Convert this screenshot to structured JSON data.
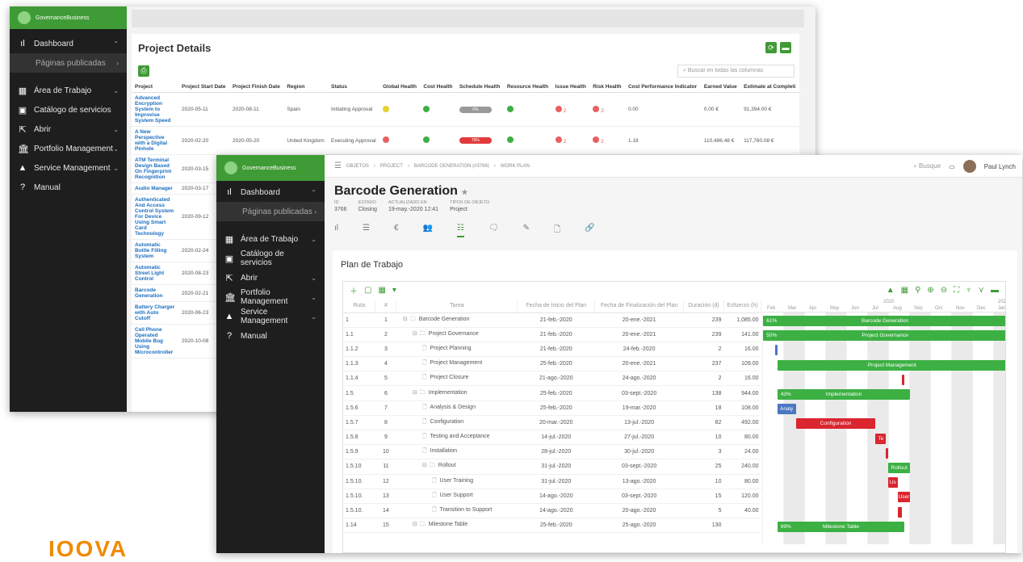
{
  "brand": "IOOVA",
  "colors": {
    "accent": "#3f9b35",
    "red": "#d9262f",
    "link": "#1a6fc0"
  },
  "back": {
    "logo": "GovernanceBusiness",
    "nav": [
      {
        "label": "Dashboard",
        "icon": "bar-chart-icon"
      },
      {
        "label": "Páginas publicadas",
        "sub": true
      },
      {
        "label": "Área de Trabajo",
        "icon": "grid-icon"
      },
      {
        "label": "Catálogo de servicios",
        "icon": "book-icon"
      },
      {
        "label": "Abrir",
        "icon": "open-icon"
      },
      {
        "label": "Portfolio Management",
        "icon": "bank-icon"
      },
      {
        "label": "Service Management",
        "icon": "mountain-icon"
      },
      {
        "label": "Manual",
        "icon": "question-icon"
      }
    ],
    "title": "Project Details",
    "search_placeholder": "Buscar en todas las columnas",
    "columns": [
      "Project",
      "Project Start Date",
      "Project Finish Date",
      "Region",
      "Status",
      "Global Health",
      "Cost Health",
      "Schedule Health",
      "Resource Health",
      "Issue Health",
      "Risk Health",
      "Cost Performance Indicator",
      "Earned Value",
      "Estimate at Completi"
    ],
    "rows": [
      {
        "project": "Advanced Encryption System to Improvise System Speed",
        "start": "2020-05-11",
        "finish": "2020-08-11",
        "region": "Spain",
        "status": "Initiating Approval",
        "global": "#e2d130",
        "cost": "#3cb043",
        "schedule": "0%",
        "schedule_color": "#999999",
        "resource": "#3cb043",
        "issue": "2",
        "risk": "2",
        "cpi": "0.00",
        "ev": "0.00 €",
        "eac": "91,394.00 €"
      },
      {
        "project": "A New Perspective with a Digital Pinhole",
        "start": "2020-02-20",
        "finish": "2020-05-20",
        "region": "United Kingdom",
        "status": "Executing Approval",
        "global": "#e86060",
        "cost": "#3cb043",
        "schedule": "79%",
        "schedule_color": "#e23b3b",
        "resource": "#3cb043",
        "issue": "2",
        "risk": "2",
        "cpi": "1.18",
        "ev": "110,486.48 €",
        "eac": "117,760.08 €"
      },
      {
        "project": "ATM Terminal Design Based On Fingerprint Recognition",
        "start": "2020-03-15"
      },
      {
        "project": "Audio Manager",
        "start": "2020-03-17"
      },
      {
        "project": "Authenticated And Access Control System For Device Using Smart Card Technology",
        "start": "2020-09-12"
      },
      {
        "project": "Automatic Bottle Filling System",
        "start": "2020-02-24"
      },
      {
        "project": "Automatic Street Light Control",
        "start": "2020-08-23"
      },
      {
        "project": "Barcode Generation",
        "start": "2020-02-21"
      },
      {
        "project": "Battery Charger with Auto Cutoff",
        "start": "2020-06-23"
      },
      {
        "project": "Cell Phone Operated Mobile Bug Using Microcontroller",
        "start": "2020-10-08"
      }
    ]
  },
  "front": {
    "breadcrumb": [
      "OBJETOS",
      "PROJECT",
      "BARCODE GENERATION (#3766)",
      "WORK PLAN"
    ],
    "search": "Busque",
    "user": "Paul Lynch",
    "title": "Barcode Generation",
    "meta": [
      {
        "k": "ID",
        "v": "3766"
      },
      {
        "k": "ESTADO",
        "v": "Closing"
      },
      {
        "k": "ACTUALIZADO EN",
        "v": "19-may.-2020 12:41"
      },
      {
        "k": "TIPOS DE OBJETO",
        "v": "Project"
      }
    ],
    "plan_title": "Plan de Trabajo",
    "columns": [
      "Ruta",
      "#",
      "Tarea",
      "Fecha de Inicio del Plan",
      "Fecha de Finalización del Plan",
      "Duración (d)",
      "Esfuerzo (h)"
    ],
    "year_labels": [
      "2020",
      "2021"
    ],
    "months": [
      "Feb",
      "Mar",
      "Apr",
      "May",
      "Jun",
      "Jul",
      "Aug",
      "Sep",
      "Oct",
      "Nov",
      "Dec",
      "Jan"
    ],
    "tasks": [
      {
        "ruta": "1",
        "n": "1",
        "name": "Barcode Generation",
        "level": 0,
        "type": "folder",
        "start": "21-feb.-2020",
        "end": "20-ene.-2021",
        "dur": "239",
        "eff": "1,085.00"
      },
      {
        "ruta": "1.1",
        "n": "2",
        "name": "Project Governance",
        "level": 1,
        "type": "folder",
        "start": "21-feb.-2020",
        "end": "20-ene.-2021",
        "dur": "239",
        "eff": "141.00"
      },
      {
        "ruta": "1.1.2",
        "n": "3",
        "name": "Project Planning",
        "level": 2,
        "type": "doc",
        "start": "21-feb.-2020",
        "end": "24-feb.-2020",
        "dur": "2",
        "eff": "16.00"
      },
      {
        "ruta": "1.1.3",
        "n": "4",
        "name": "Project Management",
        "level": 2,
        "type": "doc",
        "start": "25-feb.-2020",
        "end": "20-ene.-2021",
        "dur": "237",
        "eff": "109.00"
      },
      {
        "ruta": "1.1.4",
        "n": "5",
        "name": "Project Closure",
        "level": 2,
        "type": "doc",
        "start": "21-ago.-2020",
        "end": "24-ago.-2020",
        "dur": "2",
        "eff": "16.00"
      },
      {
        "ruta": "1.5",
        "n": "6",
        "name": "Implementation",
        "level": 1,
        "type": "folder",
        "start": "25-feb.-2020",
        "end": "03-sept.-2020",
        "dur": "138",
        "eff": "944.00"
      },
      {
        "ruta": "1.5.6",
        "n": "7",
        "name": "Analysis & Design",
        "level": 2,
        "type": "doc",
        "start": "25-feb.-2020",
        "end": "19-mar.-2020",
        "dur": "18",
        "eff": "108.00"
      },
      {
        "ruta": "1.5.7",
        "n": "8",
        "name": "Configuration",
        "level": 2,
        "type": "doc",
        "start": "20-mar.-2020",
        "end": "13-jul.-2020",
        "dur": "82",
        "eff": "492.00"
      },
      {
        "ruta": "1.5.8",
        "n": "9",
        "name": "Testing and Acceptance",
        "level": 2,
        "type": "doc",
        "start": "14-jul.-2020",
        "end": "27-jul.-2020",
        "dur": "10",
        "eff": "80.00"
      },
      {
        "ruta": "1.5.9",
        "n": "10",
        "name": "Installation",
        "level": 2,
        "type": "doc",
        "start": "28-jul.-2020",
        "end": "30-jul.-2020",
        "dur": "3",
        "eff": "24.00"
      },
      {
        "ruta": "1.5.10",
        "n": "11",
        "name": "Rollout",
        "level": 2,
        "type": "folder",
        "start": "31-jul.-2020",
        "end": "03-sept.-2020",
        "dur": "25",
        "eff": "240.00"
      },
      {
        "ruta": "1.5.10.",
        "n": "12",
        "name": "User Training",
        "level": 3,
        "type": "doc",
        "start": "31-jul.-2020",
        "end": "13-ago.-2020",
        "dur": "10",
        "eff": "80.00"
      },
      {
        "ruta": "1.5.10.",
        "n": "13",
        "name": "User Support",
        "level": 3,
        "type": "doc",
        "start": "14-ago.-2020",
        "end": "03-sept.-2020",
        "dur": "15",
        "eff": "120.00"
      },
      {
        "ruta": "1.5.10.",
        "n": "14",
        "name": "Transition to Support",
        "level": 3,
        "type": "doc",
        "start": "14-ago.-2020",
        "end": "20-ago.-2020",
        "dur": "5",
        "eff": "40.00"
      },
      {
        "ruta": "1.14",
        "n": "15",
        "name": "Milestone Table",
        "level": 1,
        "type": "folder",
        "start": "25-feb.-2020",
        "end": "25-ago.-2020",
        "dur": "130",
        "eff": ""
      }
    ],
    "bars": [
      {
        "row": 0,
        "s": 0.05,
        "e": 11.65,
        "c": "g",
        "label": "Barcode Generation",
        "pct": "61%"
      },
      {
        "row": 1,
        "s": 0.05,
        "e": 11.65,
        "c": "g",
        "label": "Project Governance",
        "pct": "50%"
      },
      {
        "row": 2,
        "s": 0.6,
        "e": 0.72,
        "c": "b",
        "label": "",
        "pct": ""
      },
      {
        "row": 3,
        "s": 0.72,
        "e": 11.65,
        "c": "g",
        "label": "Project Management",
        "pct": ""
      },
      {
        "row": 4,
        "s": 6.65,
        "e": 6.78,
        "c": "r",
        "label": "",
        "pct": ""
      },
      {
        "row": 5,
        "s": 0.72,
        "e": 7.05,
        "c": "g",
        "label": "Implementation",
        "pct": "43%"
      },
      {
        "row": 6,
        "s": 0.72,
        "e": 1.6,
        "c": "b",
        "label": "Analy",
        "pct": ""
      },
      {
        "row": 7,
        "s": 1.6,
        "e": 5.4,
        "c": "r",
        "label": "Configuration",
        "pct": ""
      },
      {
        "row": 8,
        "s": 5.4,
        "e": 5.9,
        "c": "r",
        "label": "Te",
        "pct": ""
      },
      {
        "row": 9,
        "s": 5.9,
        "e": 6.0,
        "c": "r",
        "label": "",
        "pct": ""
      },
      {
        "row": 10,
        "s": 6.0,
        "e": 7.05,
        "c": "g",
        "label": "Rollout",
        "pct": ""
      },
      {
        "row": 11,
        "s": 6.0,
        "e": 6.45,
        "c": "r",
        "label": "Us",
        "pct": ""
      },
      {
        "row": 12,
        "s": 6.45,
        "e": 7.05,
        "c": "r",
        "label": "User",
        "pct": ""
      },
      {
        "row": 13,
        "s": 6.45,
        "e": 6.65,
        "c": "r",
        "label": "",
        "pct": ""
      },
      {
        "row": 14,
        "s": 0.72,
        "e": 6.78,
        "c": "g",
        "label": "Milestone Table",
        "pct": "99%"
      }
    ]
  }
}
